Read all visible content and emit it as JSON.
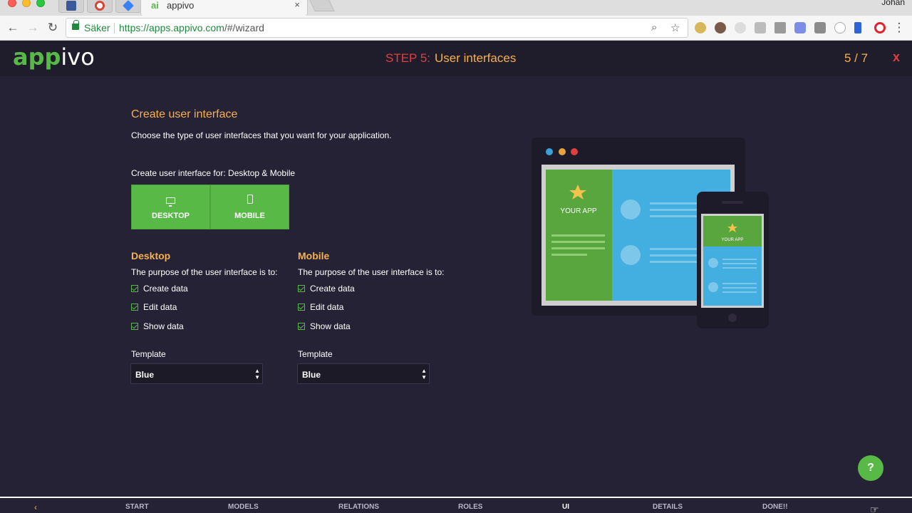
{
  "browser": {
    "tab_icon_label": "ai",
    "tab_title": "appivo",
    "tab_close": "×",
    "user": "Johan",
    "secure_label": "Säker",
    "url_scheme_host": "https://apps.appivo.com",
    "url_path": "/#/wizard",
    "back_icon": "←",
    "forward_icon": "→",
    "reload_icon": "↻",
    "search_icon": "⌕",
    "bookmark_icon": "☆",
    "menu_icon": "⋮"
  },
  "header": {
    "logo_green": "app",
    "logo_white": "ivo",
    "step_number": "STEP 5:",
    "step_name": "User interfaces",
    "progress": "5 / 7",
    "close": "x"
  },
  "main": {
    "title": "Create user interface",
    "description": "Choose the type of user interfaces that you want for your application.",
    "create_for": "Create user interface for: Desktop & Mobile",
    "platforms": [
      {
        "label": "DESKTOP",
        "icon": "monitor-icon"
      },
      {
        "label": "MOBILE",
        "icon": "phone-icon"
      }
    ],
    "desktop": {
      "heading": "Desktop",
      "purpose": "The purpose of the user interface is to:",
      "options": [
        "Create data",
        "Edit data",
        "Show data"
      ],
      "template_label": "Template",
      "template_value": "Blue"
    },
    "mobile": {
      "heading": "Mobile",
      "purpose": "The purpose of the user interface is to:",
      "options": [
        "Create data",
        "Edit data",
        "Show data"
      ],
      "template_label": "Template",
      "template_value": "Blue"
    },
    "illustration": {
      "desktop_app_text": "YOUR APP",
      "mobile_app_text": "YOUR APP"
    },
    "help": "?"
  },
  "steps": {
    "items": [
      "START",
      "MODELS",
      "RELATIONS",
      "ROLES",
      "UI",
      "DETAILS",
      "DONE!!"
    ],
    "active": "UI"
  },
  "colors": {
    "brand_green": "#58b947",
    "accent_orange": "#f5b050",
    "accent_red": "#e03f3f",
    "background": "#262236",
    "header_bg": "#1f1c2c"
  }
}
